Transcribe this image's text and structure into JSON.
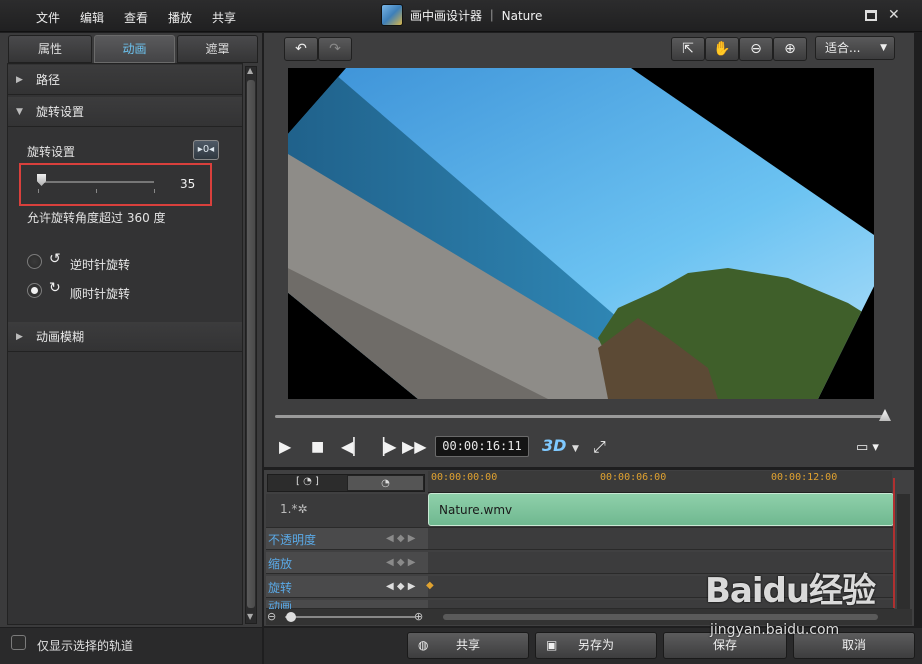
{
  "menu": [
    "文件",
    "编辑",
    "查看",
    "播放",
    "共享"
  ],
  "window": {
    "title": "画中画设计器 ｜ Nature"
  },
  "tabs": [
    {
      "label": "属性",
      "active": false
    },
    {
      "label": "动画",
      "active": true
    },
    {
      "label": "遮罩",
      "active": false
    }
  ],
  "sections": {
    "path": "路径",
    "rotation": "旋转设置",
    "blur": "动画模糊"
  },
  "rotation": {
    "label": "旋转设置",
    "keyframe_btn": "▸0◂",
    "value": "35",
    "allow_text": "允许旋转角度超过 360 度",
    "ccw_label": "逆时针旋转",
    "cw_label": "顺时针旋转",
    "selected": "cw"
  },
  "show_selected_track": "仅显示选择的轨道",
  "toolbar": {
    "fit": "适合..."
  },
  "player": {
    "timecode": "00:00:16:11",
    "mode_3d": "3D",
    "seek_position": 0.99
  },
  "timeline": {
    "ruler": [
      "00:00:00:00",
      "00:00:06:00",
      "00:00:12:00"
    ],
    "track_name": "1.*✲",
    "clip": "Nature.wmv",
    "props": [
      "不透明度",
      "缩放",
      "旋转",
      "动画"
    ]
  },
  "buttons": {
    "share": "共享",
    "save_as": "另存为",
    "save": "保存",
    "cancel": "取消"
  },
  "watermark": {
    "main": "Baidu经验",
    "sub": "jingyan.baidu.com"
  },
  "colors": {
    "accent": "#6cc3f0",
    "highlight": "#d9403c",
    "clip": "#7fc49c"
  }
}
